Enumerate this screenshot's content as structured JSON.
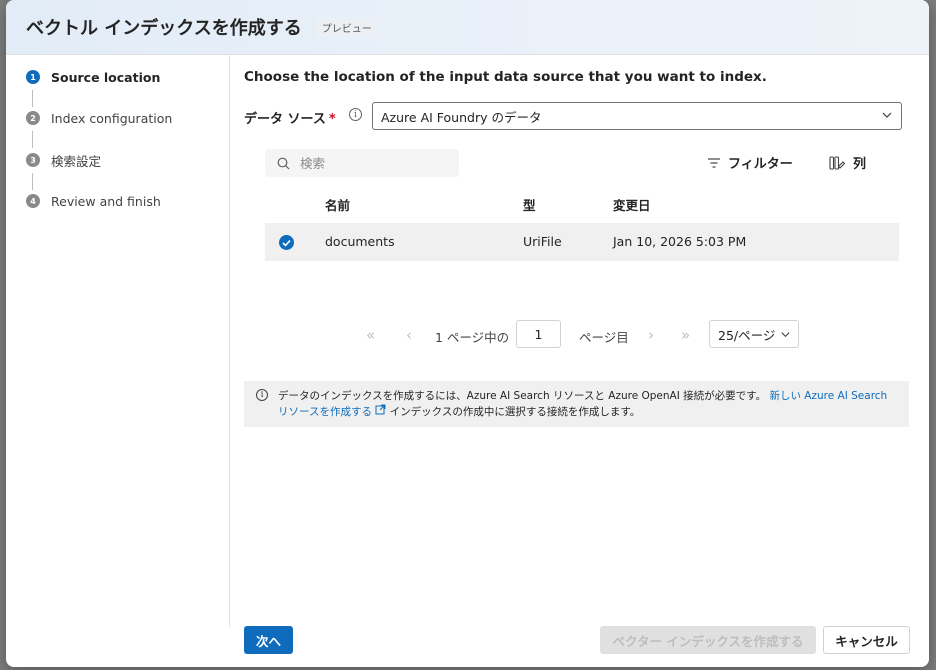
{
  "dialog": {
    "title": "ベクトル インデックスを作成する",
    "badge": "プレビュー"
  },
  "steps": [
    {
      "num": "1",
      "label": "Source location",
      "active": true
    },
    {
      "num": "2",
      "label": "Index configuration",
      "active": false
    },
    {
      "num": "3",
      "label": "検索設定",
      "active": false
    },
    {
      "num": "4",
      "label": "Review and finish",
      "active": false
    }
  ],
  "main": {
    "headline": "Choose the location of the input data source that you want to index.",
    "data_source": {
      "label": "データ ソース",
      "required_mark": "*",
      "info_glyph": "i",
      "selected": "Azure AI Foundry のデータ"
    },
    "search": {
      "placeholder": "検索",
      "value": ""
    },
    "toolbar": {
      "filter_label": "フィルター",
      "columns_label": "列"
    },
    "table": {
      "headers": [
        "名前",
        "型",
        "変更日"
      ],
      "rows": [
        {
          "name": "documents",
          "type": "UriFile",
          "modified": "Jan 10, 2026 5:03 PM",
          "selected": true
        }
      ]
    },
    "pagination": {
      "first": "«",
      "prev": "‹",
      "next": "›",
      "last": "»",
      "prefix": "1 ページ中の",
      "current_page": "1",
      "suffix": "ページ目",
      "per_page": "25/ページ"
    },
    "notice": {
      "icon_glyph": "i",
      "text_before": "データのインデックスを作成するには、Azure AI Search リソースと Azure OpenAI 接続が必要です。",
      "link_text": "新しい Azure AI Search リソースを作成する",
      "text_after": "インデックスの作成中に選択する接続を作成します。"
    }
  },
  "footer": {
    "next_label": "次へ",
    "create_label": "ベクター インデックスを作成する",
    "cancel_label": "キャンセル"
  },
  "colors": {
    "accent": "#0f6cbd",
    "required": "#c50f1f",
    "header_bg": "#e2ecf7"
  }
}
